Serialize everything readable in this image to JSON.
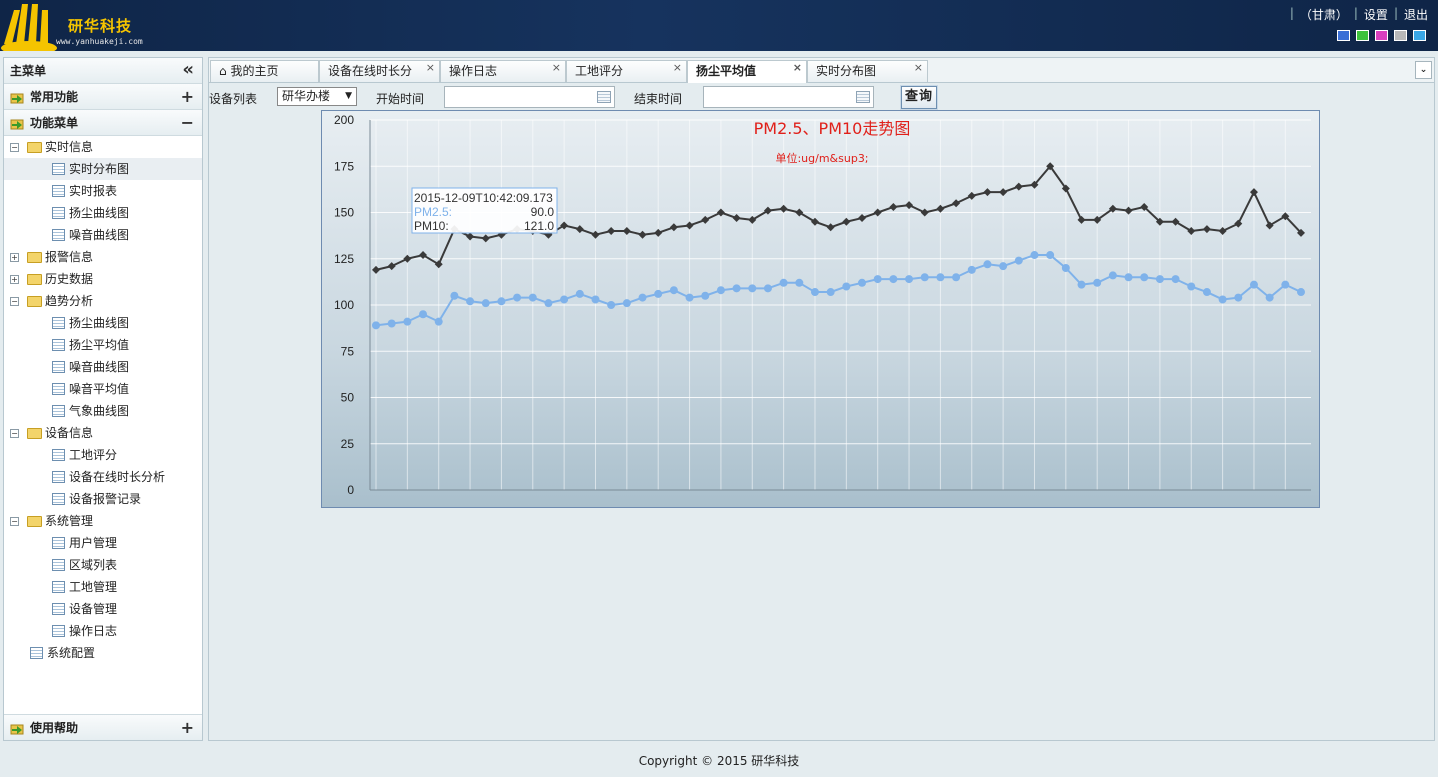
{
  "header": {
    "brand": "研华科技",
    "url": "www.yanhuakeji.com",
    "links": [
      "（甘肃）",
      "设置",
      "退出"
    ],
    "skin_colors": [
      "#3b6fd6",
      "#3dc23d",
      "#d93fbf",
      "#b8b8b8",
      "#3aa7e6"
    ]
  },
  "sidebar": {
    "title": "主菜单",
    "collapse_glyph": "«",
    "sections": {
      "common": {
        "label": "常用功能",
        "toggle": "+"
      },
      "functions": {
        "label": "功能菜单",
        "toggle": "−"
      },
      "help": {
        "label": "使用帮助",
        "toggle": "+"
      }
    },
    "tree": [
      {
        "label": "实时信息",
        "type": "folder",
        "expanded": true
      },
      {
        "label": "实时分布图",
        "type": "leaf",
        "selected": true
      },
      {
        "label": "实时报表",
        "type": "leaf"
      },
      {
        "label": "扬尘曲线图",
        "type": "leaf"
      },
      {
        "label": "噪音曲线图",
        "type": "leaf"
      },
      {
        "label": "报警信息",
        "type": "folder",
        "expanded": false
      },
      {
        "label": "历史数据",
        "type": "folder",
        "expanded": false
      },
      {
        "label": "趋势分析",
        "type": "folder",
        "expanded": true
      },
      {
        "label": "扬尘曲线图",
        "type": "leaf"
      },
      {
        "label": "扬尘平均值",
        "type": "leaf"
      },
      {
        "label": "噪音曲线图",
        "type": "leaf"
      },
      {
        "label": "噪音平均值",
        "type": "leaf"
      },
      {
        "label": "气象曲线图",
        "type": "leaf"
      },
      {
        "label": "设备信息",
        "type": "folder",
        "expanded": true
      },
      {
        "label": "工地评分",
        "type": "leaf"
      },
      {
        "label": "设备在线时长分析",
        "type": "leaf"
      },
      {
        "label": "设备报警记录",
        "type": "leaf"
      },
      {
        "label": "系统管理",
        "type": "folder",
        "expanded": true
      },
      {
        "label": "用户管理",
        "type": "leaf"
      },
      {
        "label": "区域列表",
        "type": "leaf"
      },
      {
        "label": "工地管理",
        "type": "leaf"
      },
      {
        "label": "设备管理",
        "type": "leaf"
      },
      {
        "label": "操作日志",
        "type": "leaf"
      },
      {
        "label": "系统配置",
        "type": "leaf"
      }
    ]
  },
  "tabs": [
    {
      "label": "我的主页",
      "closable": false
    },
    {
      "label": "设备在线时长分",
      "closable": true
    },
    {
      "label": "操作日志",
      "closable": true
    },
    {
      "label": "工地评分",
      "closable": true
    },
    {
      "label": "扬尘平均值",
      "closable": true,
      "active": true
    },
    {
      "label": "实时分布图",
      "closable": true
    }
  ],
  "tab_close_glyph": "×",
  "toolbar": {
    "device_label": "设备列表",
    "device_value": "研华办楼",
    "start_label": "开始时间",
    "start_value": "",
    "end_label": "结束时间",
    "end_value": "",
    "query_label": "查询"
  },
  "chart_data": {
    "type": "line",
    "title": "PM2.5、PM10走势图",
    "subtitle": "单位:ug/m&sup3;",
    "ylim": [
      0,
      200
    ],
    "yticks": [
      0,
      25,
      50,
      75,
      100,
      125,
      150,
      175,
      200
    ],
    "grid": true,
    "series": [
      {
        "name": "PM10",
        "color": "#3a3a3a",
        "marker": "diamond",
        "values": [
          119,
          121,
          125,
          127,
          122,
          141,
          137,
          136,
          138,
          141,
          140,
          138,
          143,
          141,
          138,
          140,
          140,
          138,
          139,
          142,
          143,
          146,
          150,
          147,
          146,
          151,
          152,
          150,
          145,
          142,
          145,
          147,
          150,
          153,
          154,
          150,
          152,
          155,
          159,
          161,
          161,
          164,
          165,
          175,
          163,
          146,
          146,
          152,
          151,
          153,
          145,
          145,
          140,
          141,
          140,
          144,
          161,
          143,
          148,
          139
        ]
      },
      {
        "name": "PM2.5",
        "color": "#7fb2ea",
        "marker": "circle",
        "values": [
          89,
          90,
          91,
          95,
          91,
          105,
          102,
          101,
          102,
          104,
          104,
          101,
          103,
          106,
          103,
          100,
          101,
          104,
          106,
          108,
          104,
          105,
          108,
          109,
          109,
          109,
          112,
          112,
          107,
          107,
          110,
          112,
          114,
          114,
          114,
          115,
          115,
          115,
          119,
          122,
          121,
          124,
          127,
          127,
          120,
          111,
          112,
          116,
          115,
          115,
          114,
          114,
          110,
          107,
          103,
          104,
          111,
          104,
          111,
          107
        ]
      }
    ],
    "tooltip": {
      "time": "2015-12-09T10:42:09.173",
      "rows": [
        {
          "name": "PM2.5:",
          "value": "90.0"
        },
        {
          "name": "PM10:",
          "value": "121.0"
        }
      ]
    }
  },
  "footer": {
    "text": "Copyright © 2015 研华科技"
  }
}
